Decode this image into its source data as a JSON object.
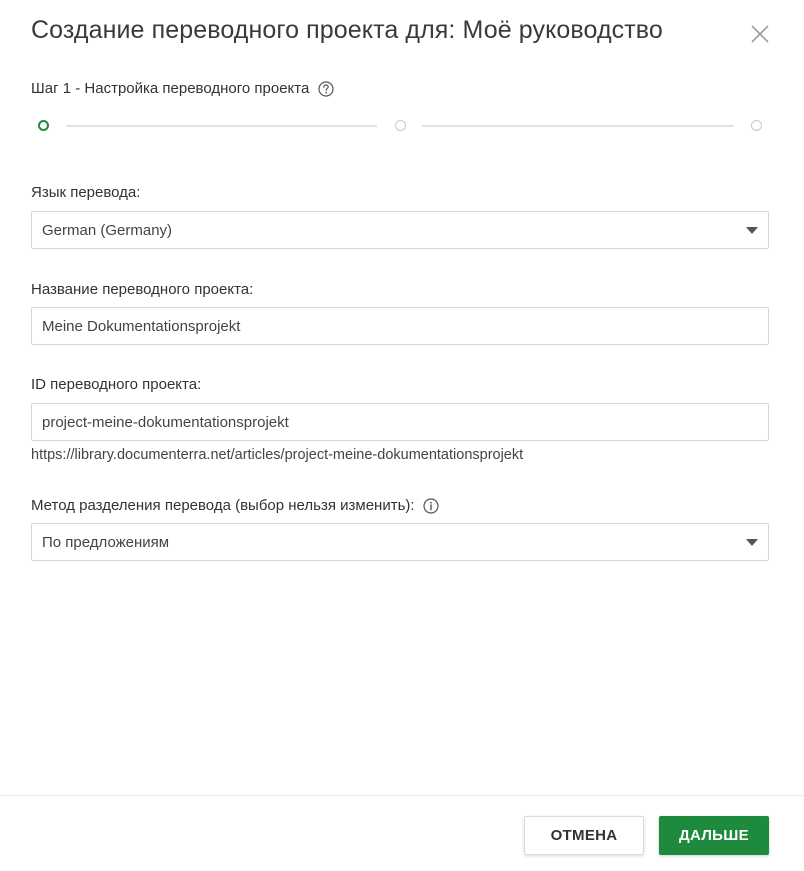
{
  "dialog": {
    "title": "Создание переводного проекта для: Моё руководство"
  },
  "step": {
    "label": "Шаг 1 - Настройка переводного проекта",
    "current": 1,
    "total": 3
  },
  "form": {
    "language_label": "Язык перевода:",
    "language_value": "German (Germany)",
    "name_label": "Название переводного проекта:",
    "name_value": "Meine Dokumentationsprojekt",
    "id_label": "ID переводного проекта:",
    "id_value": "project-meine-dokumentationsprojekt",
    "url_preview": "https://library.documenterra.net/articles/project-meine-dokumentationsprojekt",
    "split_label": "Метод разделения перевода (выбор нельзя изменить):",
    "split_value": "По предложениям"
  },
  "footer": {
    "cancel_label": "ОТМЕНА",
    "next_label": "ДАЛЬШЕ"
  },
  "colors": {
    "accent": "#1e8a3e",
    "text": "#333333"
  },
  "icons": {
    "close": "close-icon",
    "help": "help-icon",
    "info": "info-icon",
    "caret": "caret-down-icon"
  }
}
